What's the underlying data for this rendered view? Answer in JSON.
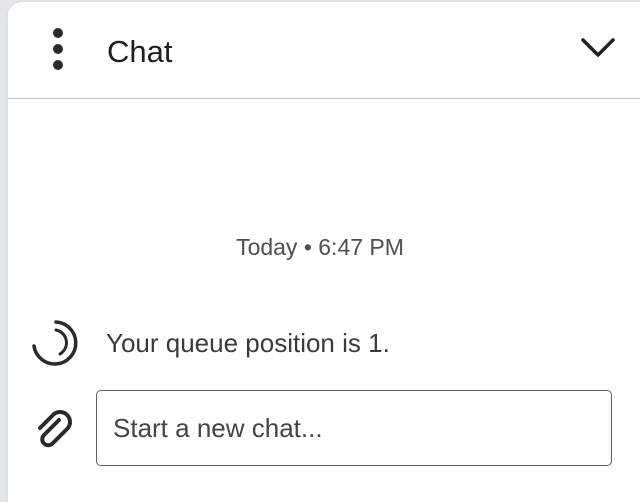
{
  "header": {
    "title": "Chat",
    "menu_icon": "more-vertical-icon",
    "collapse_icon": "chevron-down-icon"
  },
  "conversation": {
    "timestamp": "Today • 6:47 PM",
    "status_icon": "queue-spinner-icon",
    "status_message": "Your queue position is 1."
  },
  "composer": {
    "attach_icon": "paperclip-icon",
    "placeholder": "Start a new chat...",
    "value": ""
  },
  "colors": {
    "panel_bg": "#ffffff",
    "page_bg": "#e3e7ec",
    "divider": "#c4c4c4",
    "text_primary": "#1f1f1f",
    "text_secondary": "#4f4f4f"
  }
}
